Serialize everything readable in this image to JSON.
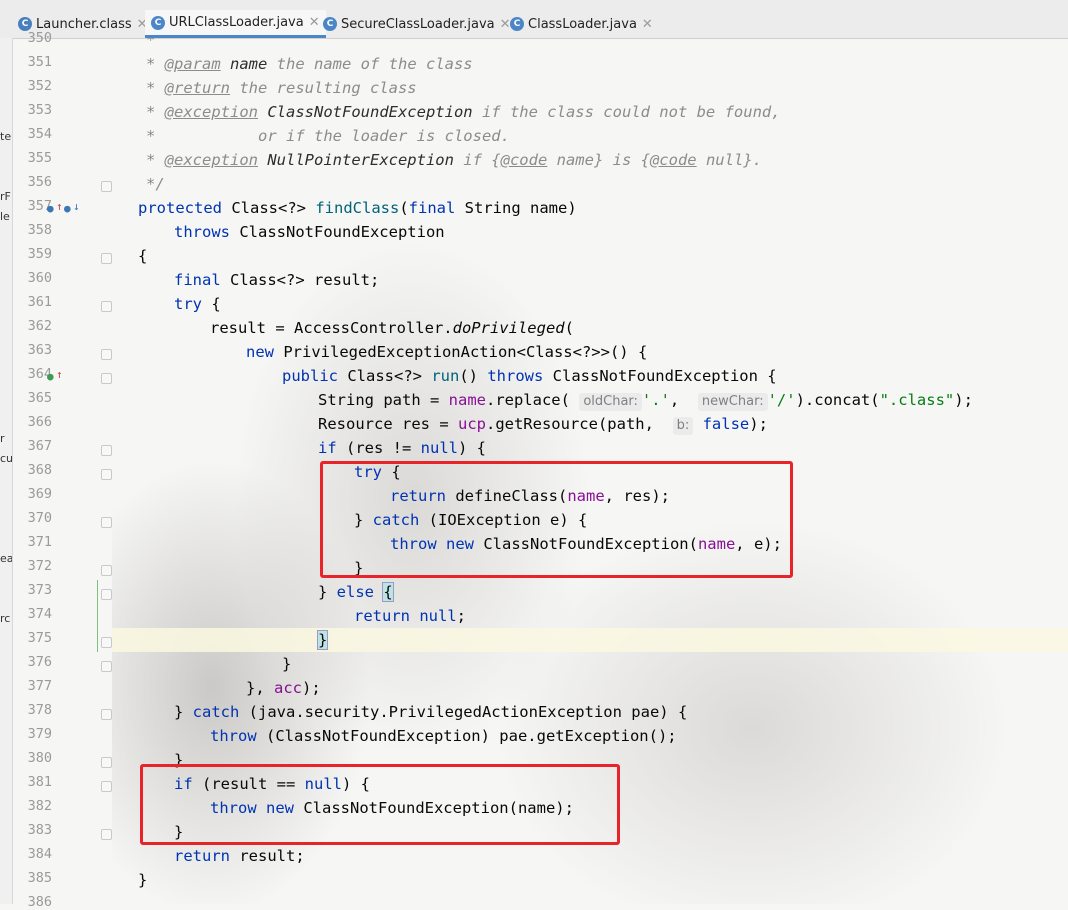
{
  "tabs": [
    {
      "label": "Launcher.class",
      "icon": "class-file-icon",
      "active": false
    },
    {
      "label": "URLClassLoader.java",
      "icon": "java-class-icon",
      "active": true
    },
    {
      "label": "SecureClassLoader.java",
      "icon": "java-class-icon",
      "active": false
    },
    {
      "label": "ClassLoader.java",
      "icon": "java-class-icon",
      "active": false
    }
  ],
  "left_panel_fragments": [
    "te",
    "rF",
    "le",
    "r",
    "cu",
    "ea",
    "rc"
  ],
  "editor": {
    "caret_line": "375",
    "line_numbers": [
      "350",
      "351",
      "352",
      "353",
      "354",
      "355",
      "356",
      "357",
      "358",
      "359",
      "360",
      "361",
      "362",
      "363",
      "364",
      "365",
      "366",
      "367",
      "368",
      "369",
      "370",
      "371",
      "372",
      "373",
      "374",
      "375",
      "376",
      "377",
      "378",
      "379",
      "380",
      "381",
      "382",
      "383",
      "384",
      "385",
      "386"
    ],
    "tokens": {
      "t350": "*",
      "t351a": "* ",
      "t351b": "@param",
      "t351c": " name",
      "t351d": " the name of the class",
      "t352a": "* ",
      "t352b": "@return",
      "t352c": " the resulting class",
      "t353a": "* ",
      "t353b": "@exception",
      "t353c": " ClassNotFoundException",
      "t353d": " if the class could not be found,",
      "t354a": "*",
      "t354b": "           or if the loader is closed.",
      "t355a": "* ",
      "t355b": "@exception",
      "t355c": " NullPointerException",
      "t355d": " if {",
      "t355e": "@code",
      "t355f": " name} is {",
      "t355g": "@code",
      "t355h": " null}.",
      "t356": "*/",
      "t357a": "protected",
      "t357b": " Class<?> ",
      "t357c": "findClass",
      "t357d": "(",
      "t357e": "final",
      "t357f": " String name)",
      "t358a": "throws",
      "t358b": " ClassNotFoundException",
      "t359": "{",
      "t360a": "final",
      "t360b": " Class<?> result;",
      "t361a": "try",
      "t361b": " {",
      "t362a": "result = AccessController.",
      "t362b": "doPrivileged",
      "t362c": "(",
      "t363a": "new",
      "t363b": " PrivilegedExceptionAction<Class<?>>() {",
      "t364a": "public",
      "t364b": " Class<?> ",
      "t364c": "run",
      "t364d": "() ",
      "t364e": "throws",
      "t364f": " ClassNotFoundException {",
      "t365a": "String path = ",
      "t365b": "name",
      "t365c": ".replace( ",
      "t365d": "oldChar:",
      "t365e": "'.'",
      "t365f": ",  ",
      "t365g": "newChar:",
      "t365h": "'/'",
      "t365i": ").concat(",
      "t365j": "\".class\"",
      "t365k": ");",
      "t366a": "Resource res = ",
      "t366b": "ucp",
      "t366c": ".getResource(path,  ",
      "t366d": "b:",
      "t366e": " false",
      "t366f": ");",
      "t367a": "if",
      "t367b": " (res != ",
      "t367c": "null",
      "t367d": ") {",
      "t368a": "try",
      "t368b": " {",
      "t369a": "return",
      "t369b": " defineClass(",
      "t369c": "name",
      "t369d": ", res);",
      "t370a": "} ",
      "t370b": "catch",
      "t370c": " (IOException e) {",
      "t371a": "throw",
      "t371b": " new",
      "t371c": " ClassNotFoundException(",
      "t371d": "name",
      "t371e": ", e);",
      "t372": "}",
      "t373a": "} ",
      "t373b": "else",
      "t373c": " ",
      "t373d": "{",
      "t374a": "return",
      "t374b": " null",
      "t374c": ";",
      "t375": "}",
      "t376": "}",
      "t377a": "}, ",
      "t377b": "acc",
      "t377c": ");",
      "t378a": "} ",
      "t378b": "catch",
      "t378c": " (java.security.PrivilegedActionException pae) {",
      "t379a": "throw",
      "t379b": " (ClassNotFoundException) pae.getException();",
      "t380": "}",
      "t381a": "if",
      "t381b": " (result == ",
      "t381c": "null",
      "t381d": ") {",
      "t382a": "throw",
      "t382b": " new",
      "t382c": " ClassNotFoundException(name);",
      "t383": "}",
      "t384a": "return",
      "t384b": " result;",
      "t385": "}"
    }
  },
  "colors": {
    "keyword": "#0033b3",
    "comment": "#8c8c8c",
    "method": "#00627a",
    "field": "#871094",
    "string": "#067d17",
    "highlight_box": "#e8232a",
    "active_tab_underline": "#4a86c8"
  }
}
